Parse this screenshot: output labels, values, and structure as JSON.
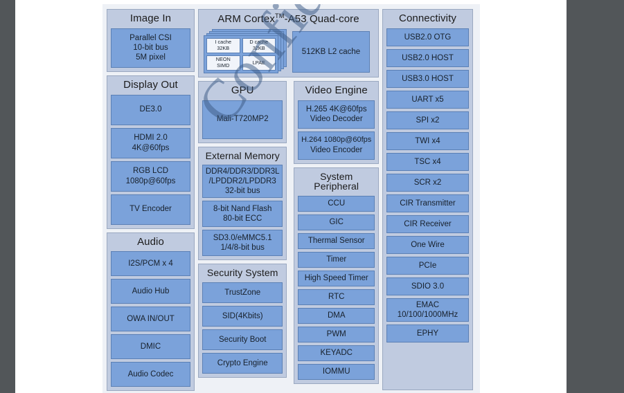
{
  "colors": {
    "block_blue": "#7ba2da",
    "group_panel": "#c0cbe0",
    "canvas_bg": "#eef1f6",
    "border_blue": "#5b80b5",
    "watermark": "#3d5c86"
  },
  "watermark": {
    "text": "Confidential"
  },
  "groups": {
    "image_in": {
      "title": "Image In",
      "blocks": [
        {
          "lines": [
            "Parallel CSI",
            "10-bit bus",
            "5M pixel"
          ]
        }
      ]
    },
    "cpu": {
      "title_pre": "ARM Cortex",
      "title_sup": "TM",
      "title_post": "-A53  Quad-core",
      "core_cells": [
        {
          "lines": [
            "I cache",
            "32KB"
          ]
        },
        {
          "lines": [
            "D cache",
            "32KB"
          ]
        },
        {
          "lines": [
            "NEON",
            "SIMD"
          ]
        },
        {
          "lines": [
            "LPAE"
          ]
        }
      ],
      "l2_cache": "512KB L2 cache"
    },
    "connectivity": {
      "title": "Connectivity",
      "blocks": [
        {
          "lines": [
            "USB2.0 OTG"
          ]
        },
        {
          "lines": [
            "USB2.0 HOST"
          ]
        },
        {
          "lines": [
            "USB3.0 HOST"
          ]
        },
        {
          "lines": [
            "UART x5"
          ]
        },
        {
          "lines": [
            "SPI x2"
          ]
        },
        {
          "lines": [
            "TWI x4"
          ]
        },
        {
          "lines": [
            "TSC x4"
          ]
        },
        {
          "lines": [
            "SCR x2"
          ]
        },
        {
          "lines": [
            "CIR Transmitter"
          ]
        },
        {
          "lines": [
            "CIR Receiver"
          ]
        },
        {
          "lines": [
            "One Wire"
          ]
        },
        {
          "lines": [
            "PCIe"
          ]
        },
        {
          "lines": [
            "SDIO 3.0"
          ]
        },
        {
          "lines": [
            "EMAC",
            "10/100/1000MHz"
          ]
        },
        {
          "lines": [
            "EPHY"
          ]
        }
      ]
    },
    "display_out": {
      "title": "Display Out",
      "blocks": [
        {
          "lines": [
            "DE3.0"
          ]
        },
        {
          "lines": [
            "HDMI 2.0",
            "4K@60fps"
          ]
        },
        {
          "lines": [
            "RGB LCD",
            "1080p@60fps"
          ]
        },
        {
          "lines": [
            "TV Encoder"
          ]
        }
      ]
    },
    "audio": {
      "title": "Audio",
      "blocks": [
        {
          "lines": [
            "I2S/PCM x 4"
          ]
        },
        {
          "lines": [
            "Audio Hub"
          ]
        },
        {
          "lines": [
            "OWA IN/OUT"
          ]
        },
        {
          "lines": [
            "DMIC"
          ]
        },
        {
          "lines": [
            "Audio Codec"
          ]
        }
      ]
    },
    "gpu": {
      "title": "GPU",
      "blocks": [
        {
          "lines": [
            "Mali-T720MP2"
          ]
        }
      ]
    },
    "external_memory": {
      "title": "External Memory",
      "blocks": [
        {
          "lines": [
            "DDR4/DDR3/DDR3L",
            "/LPDDR2/LPDDR3",
            "32-bit bus"
          ]
        },
        {
          "lines": [
            "8-bit Nand Flash",
            "80-bit ECC"
          ]
        },
        {
          "lines": [
            "SD3.0/eMMC5.1",
            "1/4/8-bit bus"
          ]
        }
      ]
    },
    "security_system": {
      "title": "Security System",
      "blocks": [
        {
          "lines": [
            "TrustZone"
          ]
        },
        {
          "lines": [
            "SID(4Kbits)"
          ]
        },
        {
          "lines": [
            "Security Boot"
          ]
        },
        {
          "lines": [
            "Crypto Engine"
          ]
        }
      ]
    },
    "video_engine": {
      "title": "Video Engine",
      "blocks": [
        {
          "lines": [
            "H.265  4K@60fps",
            "Video Decoder"
          ]
        },
        {
          "lines": [
            "H.264 1080p@60fps",
            "Video Encoder"
          ]
        }
      ]
    },
    "system_peripheral": {
      "title": "System Peripheral",
      "blocks": [
        {
          "lines": [
            "CCU"
          ]
        },
        {
          "lines": [
            "GIC"
          ]
        },
        {
          "lines": [
            "Thermal Sensor"
          ]
        },
        {
          "lines": [
            "Timer"
          ]
        },
        {
          "lines": [
            "High Speed Timer"
          ]
        },
        {
          "lines": [
            "RTC"
          ]
        },
        {
          "lines": [
            "DMA"
          ]
        },
        {
          "lines": [
            "PWM"
          ]
        },
        {
          "lines": [
            "KEYADC"
          ]
        },
        {
          "lines": [
            "IOMMU"
          ]
        }
      ]
    }
  }
}
